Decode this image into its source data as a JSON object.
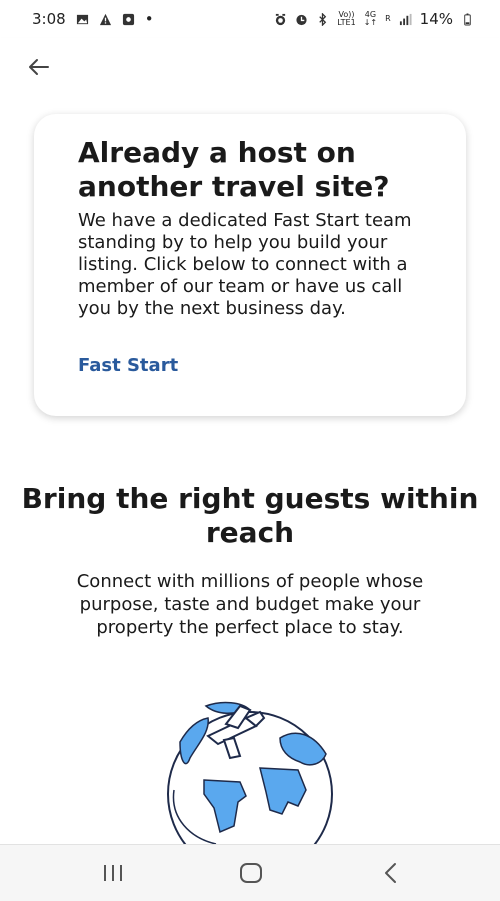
{
  "status_bar": {
    "time": "3:08",
    "dot": "•",
    "volte_top": "Vo))",
    "volte_bottom": "LTE1",
    "net_top": "4G",
    "net_bottom": "↓↑",
    "sim": "R",
    "battery": "14%"
  },
  "icons": {
    "back": "arrow-left-icon",
    "gallery": "image-icon",
    "warning": "warning-icon",
    "media": "media-icon",
    "alarm": "alarm-icon",
    "bluetooth": "bluetooth-icon",
    "signal": "signal-icon",
    "battery": "battery-icon",
    "recents": "recent-apps-icon",
    "home": "home-icon",
    "nav_back": "nav-back-icon"
  },
  "card": {
    "title": "Already a host on another travel site?",
    "body": "We have a dedicated Fast Start team standing by to help you build your listing. Click below to connect with a member of our team or have us call you by the next business day.",
    "link": "Fast Start"
  },
  "section": {
    "title": "Bring the right guests within reach",
    "body": "Connect with millions of people whose purpose, taste and budget make your property the perfect place to stay."
  },
  "colors": {
    "link": "#2a5a9c",
    "globe_land": "#5aa8ee",
    "globe_outline": "#1e2a4a"
  }
}
